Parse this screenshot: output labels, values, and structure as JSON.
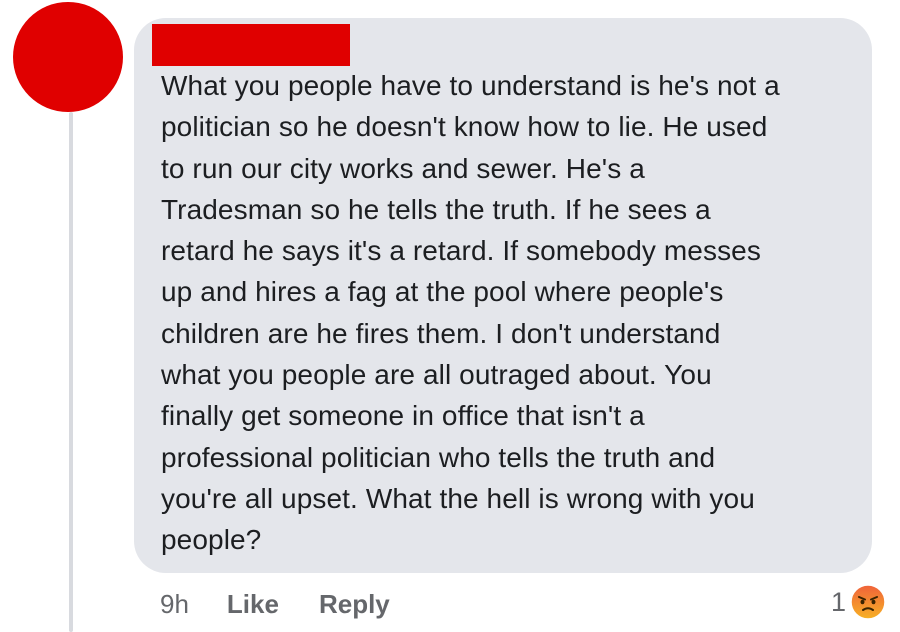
{
  "comment": {
    "author_redacted": true,
    "lines": [
      "What you people have to understand is he's not a",
      "politician so he doesn't know how to lie.  He used",
      "to run our city works and sewer. He's a",
      "Tradesman so he tells the truth.  If he sees a",
      "retard he says it's a retard.  If somebody messes",
      "up and hires a fag at the pool where people's",
      "children are he fires them.  I don't understand",
      "what you people are all outraged about.  You",
      "finally get someone in office that isn't a",
      "professional politician who tells the truth and",
      "you're all upset.  What the hell is wrong with you",
      "people?"
    ],
    "timestamp": "9h",
    "like_label": "Like",
    "reply_label": "Reply",
    "reaction_count": "1",
    "reaction_icon": "angry-face-icon"
  },
  "colors": {
    "redaction": "#e00000",
    "bubble": "#e4e6eb",
    "text": "#1c1e21",
    "meta": "#65676b",
    "angry_top": "#f0623a",
    "angry_bottom": "#f7b125"
  }
}
